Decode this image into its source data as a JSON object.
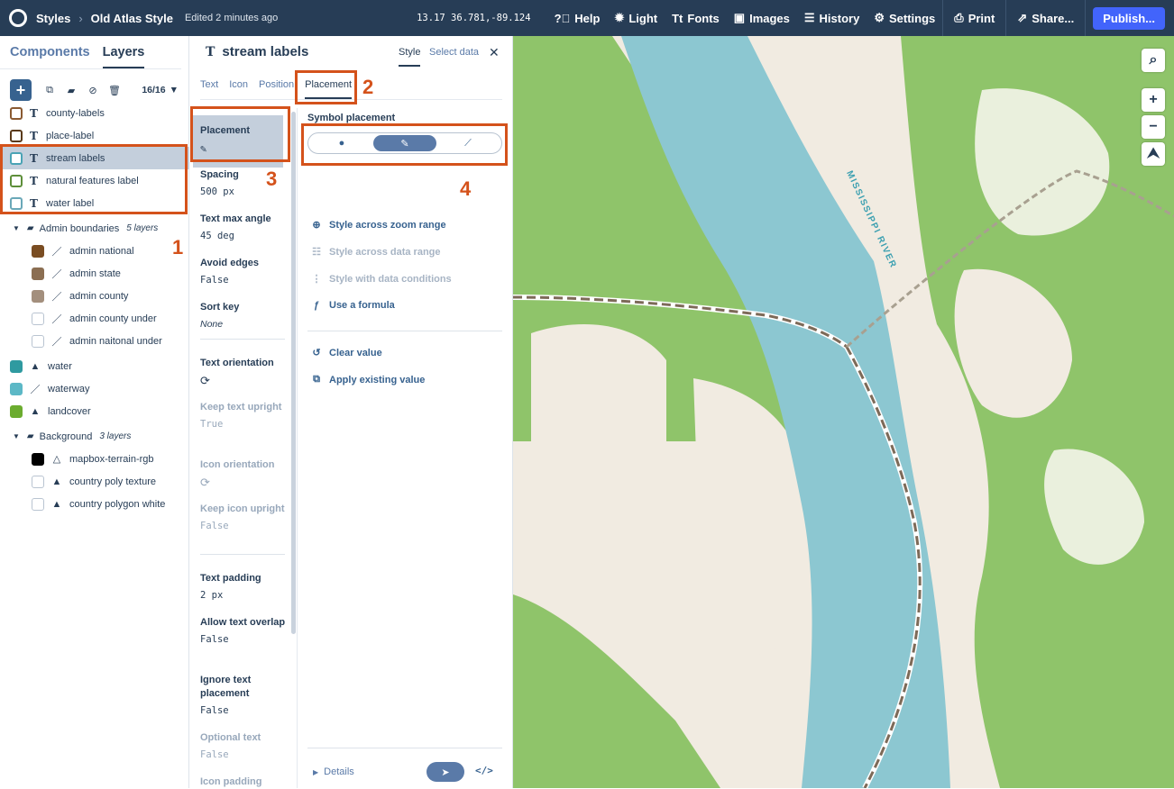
{
  "topbar": {
    "styles_label": "Styles",
    "style_name": "Old Atlas Style",
    "edited": "Edited 2 minutes ago",
    "zoom": "13.17",
    "coords": "36.781,-89.124",
    "help": "Help",
    "light": "Light",
    "fonts": "Fonts",
    "images": "Images",
    "history": "History",
    "settings": "Settings",
    "print": "Print",
    "share": "Share...",
    "publish": "Publish..."
  },
  "sidebar": {
    "tabs": [
      "Components",
      "Layers"
    ],
    "count": "16/16",
    "layers": [
      {
        "label": "county-labels",
        "color": "#8a5a32",
        "type": "text"
      },
      {
        "label": "place-label",
        "color": "#5a3a1a",
        "type": "text"
      },
      {
        "label": "stream labels",
        "color": "#4aa3b5",
        "type": "text"
      },
      {
        "label": "natural features label",
        "color": "#5e8f3a",
        "type": "text"
      },
      {
        "label": "water label",
        "color": "#6aa8b8",
        "type": "text"
      }
    ],
    "admin_group": {
      "label": "Admin boundaries",
      "sub": "5 layers"
    },
    "admin_layers": [
      {
        "label": "admin national",
        "color": "#7a4d22"
      },
      {
        "label": "admin state",
        "color": "#8b6e52"
      },
      {
        "label": "admin county",
        "color": "#a38f7d"
      },
      {
        "label": "admin county under",
        "color": "#ffffff"
      },
      {
        "label": "admin naitonal under",
        "color": "#ffffff"
      }
    ],
    "mid_layers": [
      {
        "label": "water",
        "color": "#2f9aa0"
      },
      {
        "label": "waterway",
        "color": "#5cb8c6"
      },
      {
        "label": "landcover",
        "color": "#6bac2f"
      }
    ],
    "bg_group": {
      "label": "Background",
      "sub": "3 layers"
    },
    "bg_layers": [
      {
        "label": "mapbox-terrain-rgb",
        "color": "#000000"
      },
      {
        "label": "country poly texture",
        "color": "#ffffff"
      },
      {
        "label": "country polygon white",
        "color": "#ffffff"
      }
    ]
  },
  "panel": {
    "title": "stream labels",
    "tab_style": "Style",
    "tab_select": "Select data",
    "subtabs": [
      "Text",
      "Icon",
      "Position",
      "Placement"
    ],
    "props": [
      {
        "label": "Placement",
        "value": ""
      },
      {
        "label": "Spacing",
        "value": "500 px"
      },
      {
        "label": "Text max angle",
        "value": "45 deg"
      },
      {
        "label": "Avoid edges",
        "value": "False"
      },
      {
        "label": "Sort key",
        "value": "None"
      },
      {
        "label": "Text orientation",
        "value": ""
      },
      {
        "label": "Keep text upright",
        "value": "True"
      },
      {
        "label": "Icon orientation",
        "value": ""
      },
      {
        "label": "Keep icon upright",
        "value": "False"
      },
      {
        "label": "Text padding",
        "value": "2 px"
      },
      {
        "label": "Allow text overlap",
        "value": "False"
      },
      {
        "label": "Ignore text placement",
        "value": "False"
      },
      {
        "label": "Optional text",
        "value": "False"
      },
      {
        "label": "Icon padding",
        "value": ""
      }
    ],
    "editor": {
      "label": "Symbol placement",
      "actions": [
        "Style across zoom range",
        "Style across data range",
        "Style with data conditions",
        "Use a formula",
        "Clear value",
        "Apply existing value"
      ]
    },
    "details": "Details",
    "code": "</>"
  },
  "annotations": [
    "1",
    "2",
    "3",
    "4"
  ],
  "map": {
    "river_label": "MISSISSIPPI RIVER",
    "colors": {
      "land": "#f1ebe1",
      "forest": "#8fc46a",
      "water": "#8cc7d1",
      "border": "#7d6a58"
    }
  }
}
